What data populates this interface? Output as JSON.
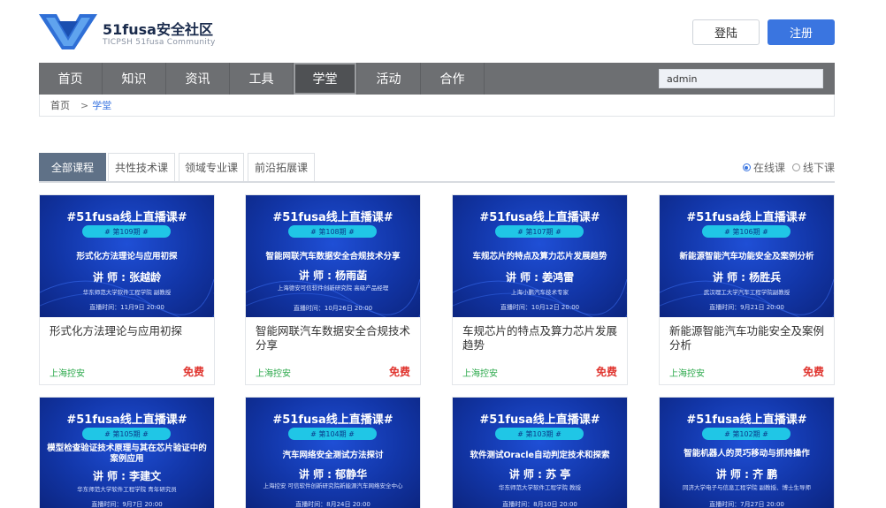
{
  "header": {
    "logo_title": "51fusa安全社区",
    "logo_subtitle": "TICPSH 51fusa Community",
    "login_label": "登陆",
    "register_label": "注册"
  },
  "nav": {
    "items": [
      "首页",
      "知识",
      "资讯",
      "工具",
      "学堂",
      "活动",
      "合作"
    ],
    "active_index": 4,
    "search_value": "admin"
  },
  "breadcrumb": {
    "home": "首页",
    "sep": ">",
    "current": "学堂"
  },
  "tabs": {
    "items": [
      "全部课程",
      "共性技术课",
      "领域专业课",
      "前沿拓展课"
    ],
    "active_index": 0,
    "radio_online": "在线课",
    "radio_offline": "线下课",
    "radio_selected": "online"
  },
  "courses": [
    {
      "banner_head": "#51fusa线上直播课#",
      "issue": "# 第109期 #",
      "topic": "形式化方法理论与应用初探",
      "lecturer": "讲 师 : 张越龄",
      "org": "华东师范大学软件工程学院 副教授",
      "time": "直播时间：11月9日 20:00",
      "title": "形式化方法理论与应用初探",
      "source": "上海控安",
      "price": "免费"
    },
    {
      "banner_head": "#51fusa线上直播课#",
      "issue": "# 第108期 #",
      "topic": "智能网联汽车数据安全合规技术分享",
      "lecturer": "讲 师 : 杨雨菡",
      "org": "上海德安可信软件创新研究院 高级产品经理",
      "time": "直播时间：10月26日 20:00",
      "title": "智能网联汽车数据安全合规技术分享",
      "source": "上海控安",
      "price": "免费"
    },
    {
      "banner_head": "#51fusa线上直播课#",
      "issue": "# 第107期 #",
      "topic": "车规芯片的特点及算力芯片发展趋势",
      "lecturer": "讲 师 : 姜鸿雷",
      "org": "上海小鹏汽车技术专家",
      "time": "直播时间：10月12日 20:00",
      "title": "车规芯片的特点及算力芯片发展趋势",
      "source": "上海控安",
      "price": "免费"
    },
    {
      "banner_head": "#51fusa线上直播课#",
      "issue": "# 第106期 #",
      "topic": "新能源智能汽车功能安全及案例分析",
      "lecturer": "讲 师 : 杨胜兵",
      "org": "武汉理工大学汽车工程学院副教授",
      "time": "直播时间：9月21日 20:00",
      "title": "新能源智能汽车功能安全及案例分析",
      "source": "上海控安",
      "price": "免费"
    },
    {
      "banner_head": "#51fusa线上直播课#",
      "issue": "# 第105期 #",
      "topic": "模型检查验证技术原理与其在芯片验证中的案例应用",
      "lecturer": "讲 师 : 李建文",
      "org": "华东师范大学软件工程学院 青年研究员",
      "time": "直播时间：9月7日 20:00"
    },
    {
      "banner_head": "#51fusa线上直播课#",
      "issue": "# 第104期 #",
      "topic": "汽车网络安全测试方法探讨",
      "lecturer": "讲 师 : 郁静华",
      "org": "上海控安 可信软件创新研究院新能源汽车网络安全中心",
      "time": "直播时间：8月24日 20:00"
    },
    {
      "banner_head": "#51fusa线上直播课#",
      "issue": "# 第103期 #",
      "topic": "软件测试Oracle自动判定技术和探索",
      "lecturer": "讲 师 : 苏 亭",
      "org": "华东师范大学软件工程学院 教授",
      "time": "直播时间：8月10日 20:00"
    },
    {
      "banner_head": "#51fusa线上直播课#",
      "issue": "# 第102期 #",
      "topic": "智能机器人的灵巧移动与抓持操作",
      "lecturer": "讲 师 : 齐 鹏",
      "org": "同济大学电子与信息工程学院 副教授、博士生导师",
      "time": "直播时间：7月27日 20:00"
    }
  ],
  "colors": {
    "accent": "#3a75e0",
    "nav_bg": "#6d6f72",
    "tab_active": "#5f7187",
    "price": "#e0352f",
    "source": "#2aa84a",
    "banner": "#1236a8"
  }
}
